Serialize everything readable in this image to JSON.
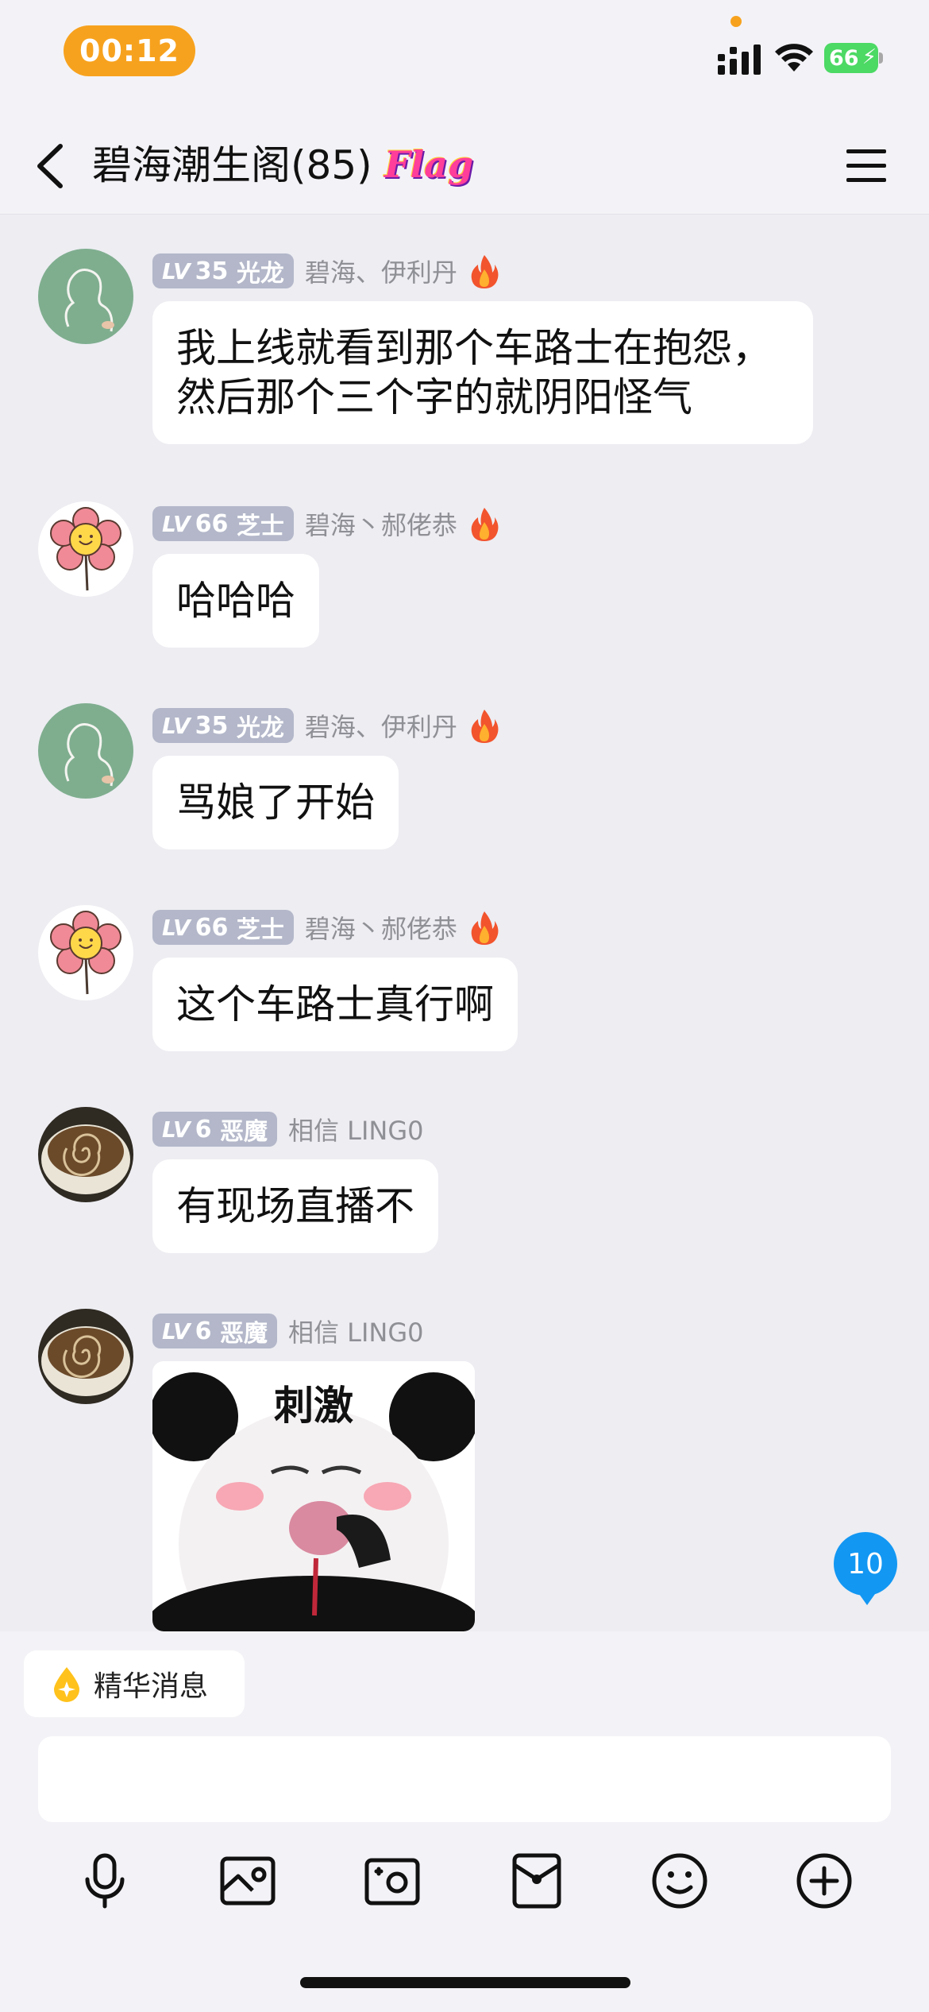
{
  "status_bar": {
    "time": "00:12",
    "battery_level": "66"
  },
  "header": {
    "back_icon": "chevron-left-icon",
    "title": "碧海潮生阁(85)",
    "flag_badge": "Flag",
    "menu_icon": "hamburger-menu-icon"
  },
  "messages": [
    {
      "level": "35",
      "level_title": "光龙",
      "sender": "碧海、伊利丹",
      "text_lines": [
        "我上线就看到那个车路士在抱怨，",
        "然后那个三个字的就阴阳怪气"
      ]
    },
    {
      "level": "66",
      "level_title": "芝士",
      "sender": "碧海丶郝佬恭",
      "text": "哈哈哈"
    },
    {
      "level": "35",
      "level_title": "光龙",
      "sender": "碧海、伊利丹",
      "text": "骂娘了开始"
    },
    {
      "level": "66",
      "level_title": "芝士",
      "sender": "碧海丶郝佬恭",
      "text": "这个车路士真行啊"
    },
    {
      "level": "6",
      "level_title": "恶魔",
      "sender": "相信 LING0",
      "text": "有现场直播不"
    },
    {
      "level": "6",
      "level_title": "恶魔",
      "sender": "相信 LING0",
      "sticker_caption": "刺激"
    }
  ],
  "level_prefix": "LV",
  "unread_count": "10",
  "input": {
    "essence_label": "精华消息",
    "placeholder": ""
  },
  "toolbar_icons": [
    "microphone-icon",
    "image-icon",
    "camera-icon",
    "red-packet-icon",
    "emoji-icon",
    "add-icon"
  ],
  "colors": {
    "accent_orange": "#f7a21e",
    "level_badge": "#b3b7c9",
    "unread_blue": "#1297f3",
    "background": "#ededf2"
  }
}
